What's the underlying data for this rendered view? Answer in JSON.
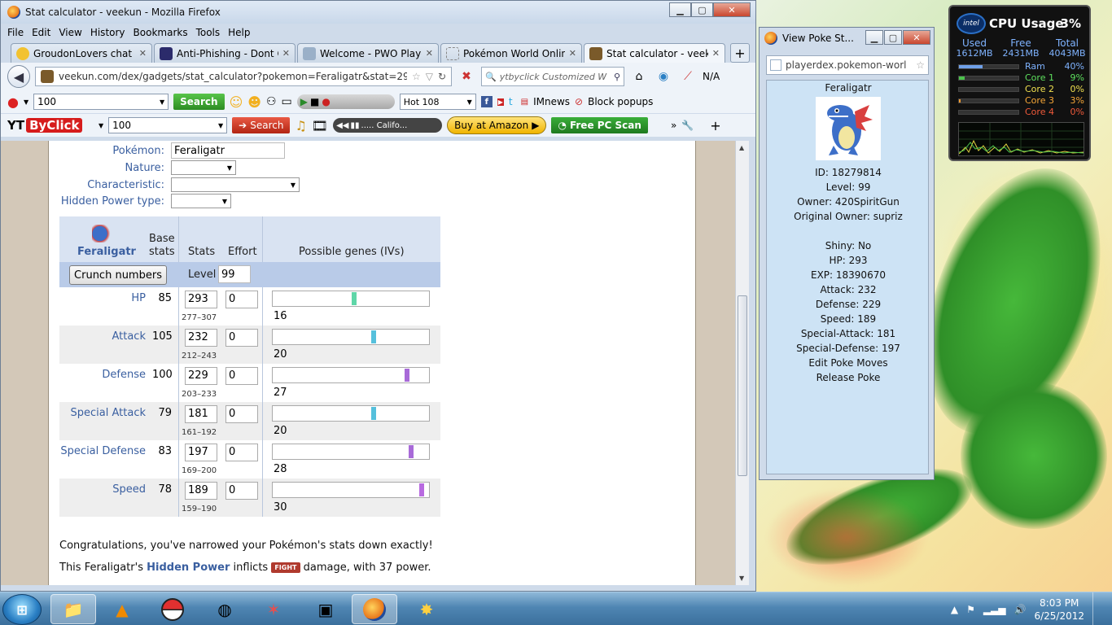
{
  "browser": {
    "title": "Stat calculator - veekun - Mozilla Firefox",
    "menu": [
      "File",
      "Edit",
      "View",
      "History",
      "Bookmarks",
      "Tools",
      "Help"
    ],
    "tabs": [
      {
        "label": "GroudonLovers chat gr...",
        "icon_color": "#f2c230"
      },
      {
        "label": "Anti-Phishing - Dont G...",
        "icon_color": "#2b2b6b"
      },
      {
        "label": "Welcome - PWO Player...",
        "icon_color": "#9ab0c8"
      },
      {
        "label": "Pokémon World Onlin...",
        "icon_color": "#d0d6de"
      },
      {
        "label": "Stat calculator - veekun",
        "icon_color": "#7a5a2a"
      }
    ],
    "url": "veekun.com/dex/gadgets/stat_calculator?pokemon=Feraligatr&stat=293%2C",
    "search_placeholder": "ytbyclick Customized W",
    "na_label": "N/A",
    "toolbar1": {
      "combo_value": "100",
      "search_label": "Search",
      "hot_label": "Hot 108",
      "imnews": "IMnews",
      "block_popups": "Block popups"
    },
    "toolbar2": {
      "logo_a": "YT",
      "logo_b": "ByClick",
      "combo_value": "100",
      "search_label": "Search",
      "media_text": "..... Califo...",
      "amazon": "Buy at Amazon",
      "freepc": "Free PC Scan"
    }
  },
  "page": {
    "fields": {
      "pokemon_label": "Pokémon:",
      "pokemon_value": "Feraligatr",
      "nature_label": "Nature:",
      "characteristic_label": "Characteristic:",
      "hidden_power_label": "Hidden Power type:"
    },
    "table": {
      "pokemon_name": "Feraligatr",
      "base_stats_header": "Base stats",
      "base_line1": "Base",
      "base_line2": "stats",
      "stats_header": "Stats",
      "effort_header": "Effort",
      "genes_header": "Possible genes (IVs)",
      "crunch_label": "Crunch numbers",
      "level_label": "Level",
      "level_value": "99",
      "rows": [
        {
          "name": "HP",
          "base": "85",
          "value": "293",
          "effort": "0",
          "range": "277–307",
          "iv": "16",
          "iv_color": "#5fd6a8",
          "iv_pos": 0.52
        },
        {
          "name": "Attack",
          "base": "105",
          "value": "232",
          "effort": "0",
          "range": "212–243",
          "iv": "20",
          "iv_color": "#55c0dc",
          "iv_pos": 0.65
        },
        {
          "name": "Defense",
          "base": "100",
          "value": "229",
          "effort": "0",
          "range": "203–233",
          "iv": "27",
          "iv_color": "#a86ad8",
          "iv_pos": 0.87
        },
        {
          "name": "Special Attack",
          "base": "79",
          "value": "181",
          "effort": "0",
          "range": "161–192",
          "iv": "20",
          "iv_color": "#55c0dc",
          "iv_pos": 0.65
        },
        {
          "name": "Special Defense",
          "base": "83",
          "value": "197",
          "effort": "0",
          "range": "169–200",
          "iv": "28",
          "iv_color": "#a86ad8",
          "iv_pos": 0.9
        },
        {
          "name": "Speed",
          "base": "78",
          "value": "189",
          "effort": "0",
          "range": "159–190",
          "iv": "30",
          "iv_color": "#b86ae0",
          "iv_pos": 0.97
        }
      ]
    },
    "message1": "Congratulations, you've narrowed your Pokémon's stats down exactly!",
    "message2_a": "This Feraligatr's ",
    "message2_link": "Hidden Power",
    "message2_b": " inflicts ",
    "message2_type": "FIGHT",
    "message2_c": " damage, with 37 power."
  },
  "popup": {
    "title": "View Poke St...",
    "url": "playerdex.pokemon-worl",
    "lines": [
      "Feraligatr",
      "ID: 18279814",
      "Level: 99",
      "Owner: 420SpiritGun",
      "Original Owner: supriz",
      "Shiny: No",
      "HP: 293",
      "EXP: 18390670",
      "Attack: 232",
      "Defense: 229",
      "Speed: 189",
      "Special-Attack: 181",
      "Special-Defense: 197",
      "Edit Poke Moves",
      "Release Poke"
    ]
  },
  "cpu": {
    "logo": "intel",
    "title": "CPU Usage",
    "percent": "3%",
    "used_label": "Used",
    "free_label": "Free",
    "total_label": "Total",
    "used": "1612MB",
    "free": "2431MB",
    "total": "4043MB",
    "rows": [
      {
        "label": "Ram",
        "pct": "40%",
        "fill": 0.4,
        "color": "#6fa0e8",
        "label_color": "#7fb3ff"
      },
      {
        "label": "Core 1",
        "pct": "9%",
        "fill": 0.09,
        "color": "#4cc24c",
        "label_color": "#5ee05e"
      },
      {
        "label": "Core 2",
        "pct": "0%",
        "fill": 0.0,
        "color": "#e0d040",
        "label_color": "#f0e050"
      },
      {
        "label": "Core 3",
        "pct": "3%",
        "fill": 0.03,
        "color": "#f09a30",
        "label_color": "#f8a838"
      },
      {
        "label": "Core 4",
        "pct": "0%",
        "fill": 0.0,
        "color": "#e04a30",
        "label_color": "#f05a3a"
      }
    ]
  },
  "taskbar": {
    "start": "⊞",
    "time": "8:03 PM",
    "date": "6/25/2012"
  }
}
